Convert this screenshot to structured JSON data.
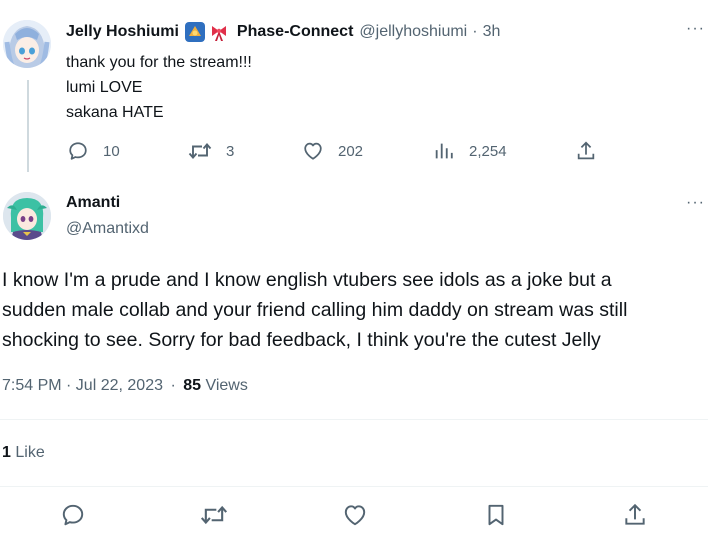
{
  "parent_tweet": {
    "display_name": "Jelly Hoshiumi",
    "org_label": "Phase-Connect",
    "handle": "@jellyhoshiumi",
    "separator": "·",
    "time": "3h",
    "lines": [
      "thank you for the stream!!!",
      "lumi LOVE",
      "sakana HATE"
    ],
    "stats": {
      "replies": "10",
      "retweets": "3",
      "likes": "202",
      "views": "2,254"
    }
  },
  "main_tweet": {
    "display_name": "Amanti",
    "handle": "@Amantixd",
    "text_lines": [
      "I know I'm a prude and I know english vtubers see idols as a joke but a",
      "sudden male collab and your friend calling him daddy on stream was still",
      "shocking to see. Sorry for bad feedback, I think you're the cutest Jelly"
    ],
    "timestamp": "7:54 PM · Jul 22, 2023",
    "dot": "·",
    "views_count": "85",
    "views_label": "Views",
    "likes_count": "1",
    "likes_label": "Like"
  },
  "icons": {
    "more": "more-icon",
    "reply": "reply-icon",
    "retweet": "retweet-icon",
    "like": "heart-icon",
    "views": "views-icon",
    "share": "share-icon",
    "bookmark": "bookmark-icon"
  },
  "colors": {
    "text": "#0f1419",
    "muted": "#536471",
    "divider": "#eff3f4",
    "thread_line": "#cfd9de"
  }
}
